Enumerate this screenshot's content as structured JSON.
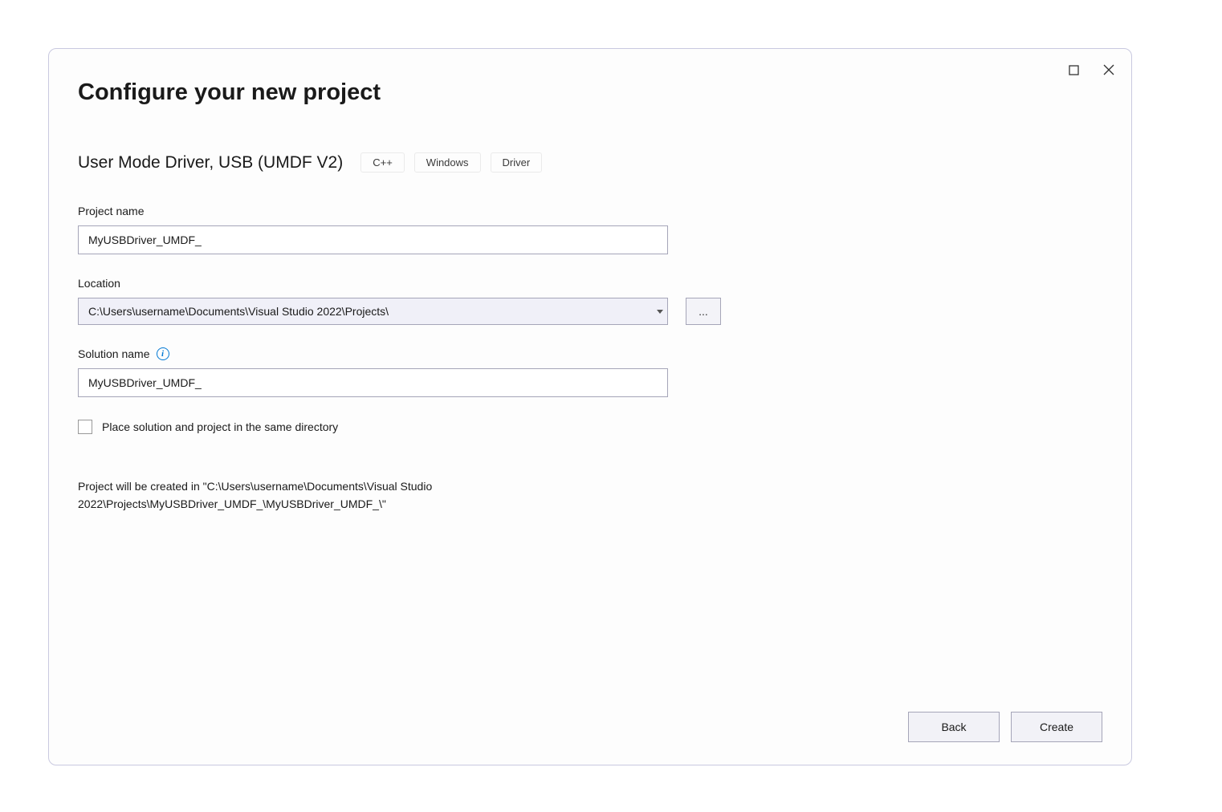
{
  "window": {
    "title": "Configure your new project"
  },
  "template": {
    "name": "User Mode Driver, USB (UMDF V2)",
    "tags": [
      "C++",
      "Windows",
      "Driver"
    ]
  },
  "fields": {
    "projectName": {
      "label": "Project name",
      "value": "MyUSBDriver_UMDF_"
    },
    "location": {
      "label": "Location",
      "value": "C:\\Users\\username\\Documents\\Visual Studio 2022\\Projects\\",
      "browseLabel": "..."
    },
    "solutionName": {
      "label": "Solution name",
      "value": "MyUSBDriver_UMDF_"
    },
    "placeSameDir": {
      "label": "Place solution and project in the same directory",
      "checked": false
    }
  },
  "pathPreview": "Project will be created in \"C:\\Users\\username\\Documents\\Visual Studio 2022\\Projects\\MyUSBDriver_UMDF_\\MyUSBDriver_UMDF_\\\"",
  "footer": {
    "back": "Back",
    "create": "Create"
  }
}
